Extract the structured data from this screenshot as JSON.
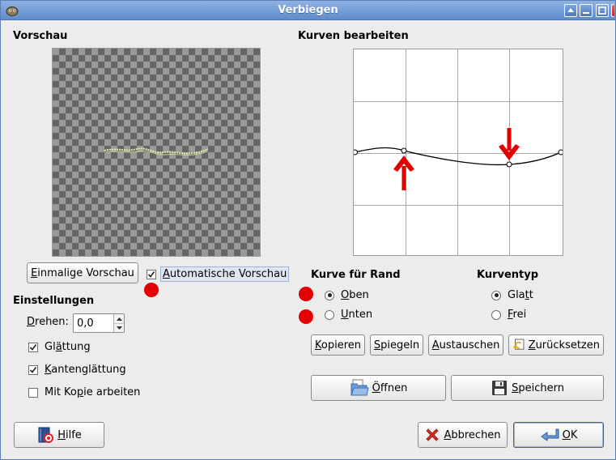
{
  "window": {
    "title": "Verbiegen"
  },
  "preview": {
    "section_title": "Vorschau",
    "once_button": {
      "prefix": "",
      "mnemonic": "E",
      "rest": "inmalige Vorschau"
    },
    "auto_checkbox": {
      "prefix": "",
      "mnemonic": "A",
      "rest": "utomatische Vorschau",
      "checked": true
    }
  },
  "settings": {
    "section_title": "Einstellungen",
    "rotate": {
      "prefix": "",
      "mnemonic": "D",
      "rest": "rehen:",
      "value": "0,0"
    },
    "smoothing": {
      "prefix": "Gl",
      "mnemonic": "ä",
      "rest": "ttung",
      "checked": true
    },
    "antialias": {
      "prefix": "",
      "mnemonic": "K",
      "rest": "antenglättung",
      "checked": true
    },
    "copy": {
      "prefix": "Mit Ko",
      "mnemonic": "p",
      "rest": "ie arbeiten",
      "checked": false
    }
  },
  "curves": {
    "section_title": "Kurven bearbeiten",
    "edge_title": "Kurve für Rand",
    "edge_top": {
      "prefix": "",
      "mnemonic": "O",
      "rest": "ben",
      "selected": true
    },
    "edge_bottom": {
      "prefix": "",
      "mnemonic": "U",
      "rest": "nten",
      "selected": false
    },
    "type_title": "Kurventyp",
    "type_smooth": {
      "prefix": "Gla",
      "mnemonic": "t",
      "rest": "t",
      "selected": true
    },
    "type_free": {
      "prefix": "",
      "mnemonic": "F",
      "rest": "rei",
      "selected": false
    },
    "buttons": {
      "copy": {
        "prefix": "",
        "mnemonic": "K",
        "rest": "opieren"
      },
      "mirror": {
        "prefix": "",
        "mnemonic": "S",
        "rest": "piegeln"
      },
      "swap": {
        "prefix": "",
        "mnemonic": "A",
        "rest": "ustauschen"
      },
      "reset": {
        "prefix": "",
        "mnemonic": "Z",
        "rest": "urücksetzen"
      },
      "open": {
        "prefix": "",
        "mnemonic": "Ö",
        "rest": "ffnen"
      },
      "save": {
        "prefix": "",
        "mnemonic": "S",
        "rest": "peichern"
      }
    }
  },
  "footer": {
    "help": {
      "prefix": "",
      "mnemonic": "H",
      "rest": "ilfe"
    },
    "cancel": {
      "prefix": "",
      "mnemonic": "A",
      "rest": "bbrechen"
    },
    "ok": {
      "prefix": "",
      "mnemonic": "O",
      "rest": "K"
    }
  },
  "colors": {
    "annotation_red": "#e20000",
    "titlebar": "#6b95d4"
  }
}
